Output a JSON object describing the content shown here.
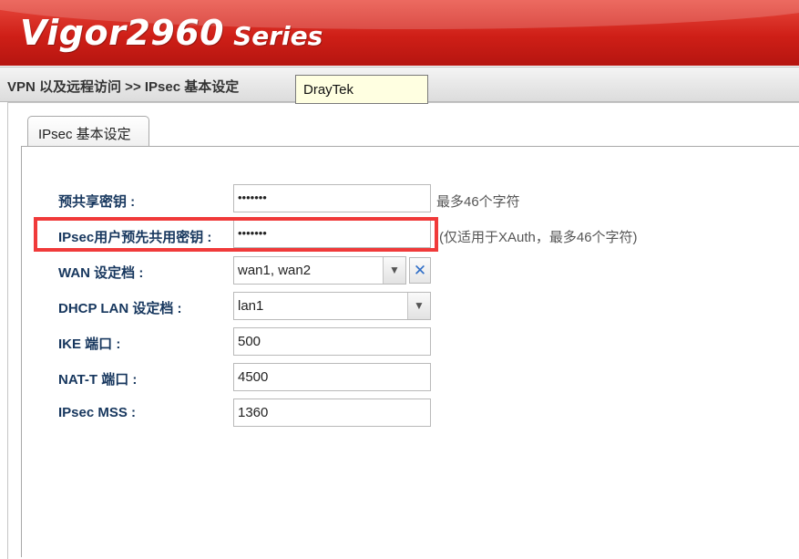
{
  "header": {
    "model": "Vigor2960",
    "series": "Series"
  },
  "breadcrumb": "VPN 以及远程访问 >> IPsec 基本设定",
  "tooltip": "DrayTek",
  "tab": {
    "label": "IPsec 基本设定"
  },
  "form": {
    "psk": {
      "label": "预共享密钥 :",
      "value": "•••••••",
      "hint": "最多46个字符"
    },
    "xauth_psk": {
      "label": "IPsec用户预先共用密钥 :",
      "value": "•••••••",
      "hint": "(仅适用于XAuth，最多46个字符)"
    },
    "wan_profile": {
      "label": "WAN 设定档 :",
      "value": "wan1, wan2"
    },
    "dhcp_lan_profile": {
      "label": "DHCP LAN 设定档 :",
      "value": "lan1"
    },
    "ike_port": {
      "label": "IKE 端口 :",
      "value": "500"
    },
    "natt_port": {
      "label": "NAT-T 端口 :",
      "value": "4500"
    },
    "ipsec_mss": {
      "label": "IPsec MSS :",
      "value": "1360"
    }
  },
  "icons": {
    "dropdown": "chevron-down-icon",
    "clear": "close-icon"
  },
  "colors": {
    "banner_red": "#cf1f17",
    "label_blue": "#17375e",
    "highlight_red": "#f03a3a",
    "tooltip_bg": "#ffffe1"
  }
}
